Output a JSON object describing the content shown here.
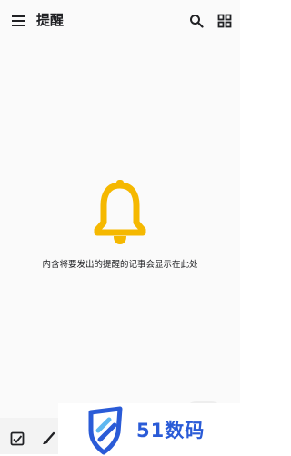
{
  "header": {
    "title": "提醒",
    "menu_icon": "menu-icon",
    "search_icon": "search-icon",
    "view_icon": "grid-view-icon"
  },
  "empty_state": {
    "icon": "bell-icon",
    "message": "内含将要发出的提醒的记事会显示在此处"
  },
  "bottom_bar": {
    "checkbox_icon": "checkbox-icon",
    "brush_icon": "brush-icon"
  },
  "watermark": {
    "text": "51数码"
  },
  "colors": {
    "bell": "#f5b800",
    "background": "#fafafa",
    "watermark_blue": "#2a5bd7"
  }
}
